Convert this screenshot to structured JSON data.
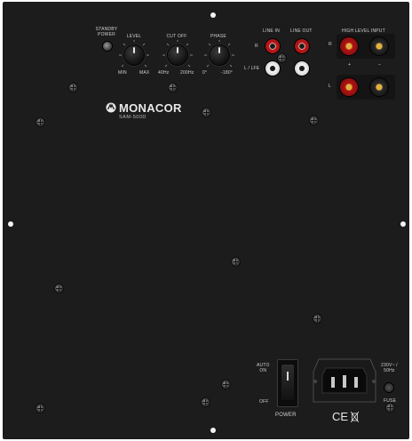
{
  "brand": {
    "name": "MONACOR",
    "model": "SAM-500D",
    "logo_icon": "monacor-logo-icon"
  },
  "controls": {
    "standby_label": "STANDBY\nPOWER",
    "level": {
      "label": "LEVEL",
      "min": "MIN",
      "max": "MAX"
    },
    "cutoff": {
      "label": "CUT OFF",
      "min": "40Hz",
      "max": "200Hz"
    },
    "phase": {
      "label": "PHASE",
      "min": "0°",
      "max": "-180°"
    }
  },
  "inputs": {
    "line_in": "LINE IN",
    "line_out": "LINE OUT",
    "r_label": "R",
    "l_label": "L / LFE",
    "high_level": "HIGH LEVEL INPUT",
    "hl_r": "R",
    "hl_l": "L",
    "plus": "+",
    "minus": "–"
  },
  "power": {
    "auto_on": "AUTO\nON",
    "off": "OFF",
    "power_label": "POWER",
    "mains": "230V~ /\n50Hz",
    "fuse": "FUSE",
    "ce": "CE"
  },
  "colors": {
    "panel": "#1c1c1c",
    "rca_red": "#c21a1a",
    "post_red": "#b11414",
    "gold": "#e0b040"
  }
}
